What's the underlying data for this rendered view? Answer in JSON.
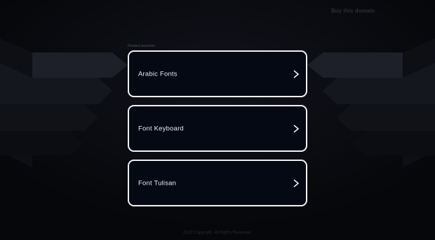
{
  "header": {
    "buy_link": "Buy this domain"
  },
  "related": {
    "label": "Related searches",
    "items": [
      {
        "label": "Arabic Fonts"
      },
      {
        "label": "Font Keyboard"
      },
      {
        "label": "Font Tulisan"
      }
    ]
  },
  "footer": {
    "copyright": "2023 Copyright. All Rights Reserved."
  },
  "colors": {
    "background": "#07080c",
    "card_background": "#050914",
    "card_border": "#eef0f5",
    "text": "#e8eaf0"
  },
  "icons": {
    "item_arrow": "chevron-right-icon"
  }
}
